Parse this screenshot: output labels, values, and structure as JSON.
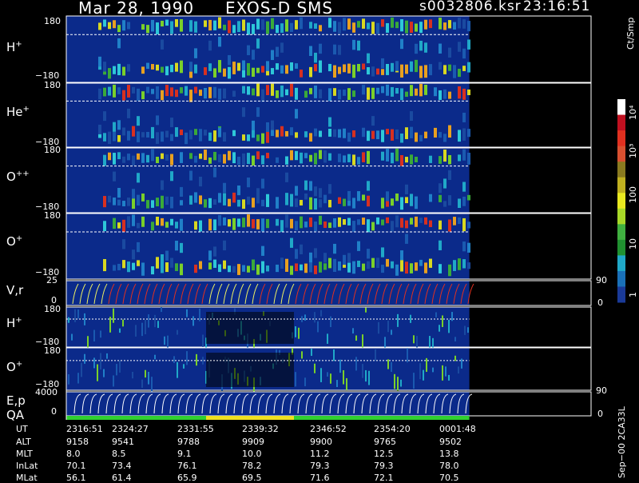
{
  "header": {
    "date": "Mar 28, 1990",
    "mission": "EXOS-D SMS",
    "file": "s0032806.ksr",
    "time": "23:16:51"
  },
  "panels": {
    "hplus_top": {
      "base": "H",
      "sup": "+",
      "ymax": "180",
      "ymin": "−180"
    },
    "heplus": {
      "base": "He",
      "sup": "+",
      "ymax": "180",
      "ymin": "−180"
    },
    "oplusplus": {
      "base": "O",
      "sup": "++",
      "ymax": "180",
      "ymin": "−180"
    },
    "oplus": {
      "base": "O",
      "sup": "+",
      "ymax": "180",
      "ymin": "−180"
    },
    "vr": {
      "label": "V,r",
      "ymax": "25",
      "ymin": "0",
      "right_top": "90",
      "right_bottom": "0"
    },
    "hplus_low": {
      "base": "H",
      "sup": "+",
      "ymax": "180",
      "ymin": "−180"
    },
    "oplus_low": {
      "base": "O",
      "sup": "+",
      "ymax": "180",
      "ymin": "−180"
    },
    "ep": {
      "label": "E,p",
      "ymax": "4000",
      "ymin": "0",
      "right_top": "90",
      "right_bottom": "0"
    },
    "qa": {
      "label": "QA"
    }
  },
  "colorbar": {
    "unit": "Ct/Smp",
    "labels": [
      "10⁴",
      "10³",
      "100",
      "10",
      "1"
    ]
  },
  "footer": {
    "version": "Sep−00  2CA33L",
    "rows": [
      {
        "label": "UT",
        "values": [
          "2316:51",
          "2324:27",
          "2331:55",
          "2339:32",
          "2346:52",
          "2354:20",
          "0001:48"
        ]
      },
      {
        "label": "ALT",
        "values": [
          "9158",
          "9541",
          "9788",
          "9909",
          "9900",
          "9765",
          "9502"
        ]
      },
      {
        "label": "MLT",
        "values": [
          "8.0",
          "8.5",
          "9.1",
          "10.0",
          "11.2",
          "12.5",
          "13.8"
        ]
      },
      {
        "label": "InLat",
        "values": [
          "70.1",
          "73.4",
          "76.1",
          "78.2",
          "79.3",
          "79.3",
          "78.0"
        ]
      },
      {
        "label": "MLat",
        "values": [
          "56.1",
          "61.4",
          "65.9",
          "69.5",
          "71.6",
          "72.1",
          "70.5"
        ]
      }
    ]
  },
  "colors": {
    "background": "#000000",
    "field": "#0b2a8a",
    "data_end_fraction": 0.987
  },
  "chart_data": {
    "type": "heatmap",
    "x_ticks": [
      "2316:51",
      "2324:27",
      "2331:55",
      "2339:32",
      "2346:52",
      "2354:20",
      "0001:48"
    ],
    "panels": [
      {
        "label": "H+",
        "ylim": [
          -180,
          180
        ]
      },
      {
        "label": "He+",
        "ylim": [
          -180,
          180
        ]
      },
      {
        "label": "O++",
        "ylim": [
          -180,
          180
        ]
      },
      {
        "label": "O+",
        "ylim": [
          -180,
          180
        ]
      },
      {
        "label": "V,r",
        "ylim": [
          0,
          25
        ],
        "ylim_right": [
          0,
          90
        ]
      },
      {
        "label": "H+",
        "ylim": [
          -180,
          180
        ]
      },
      {
        "label": "O+",
        "ylim": [
          -180,
          180
        ]
      },
      {
        "label": "E,p",
        "ylim": [
          0,
          4000
        ],
        "ylim_right": [
          0,
          90
        ]
      },
      {
        "label": "QA"
      }
    ],
    "colorbar": {
      "unit": "Ct/Smp",
      "scale": "log",
      "range": [
        1,
        10000
      ]
    }
  }
}
